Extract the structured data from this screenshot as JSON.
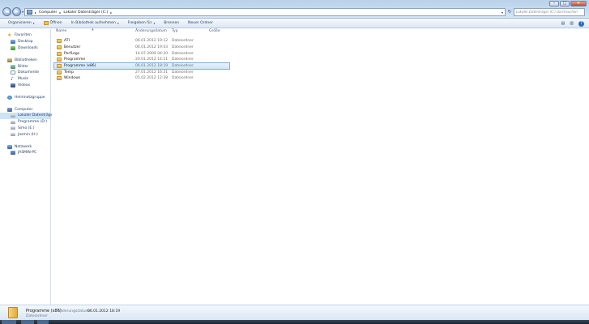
{
  "window": {
    "controls": {
      "minimize": "–",
      "maximize": "□",
      "close": "✕"
    }
  },
  "nav": {
    "back": "◄",
    "forward": "►",
    "dropdown": "▾"
  },
  "address": {
    "crumbs": [
      "Computer",
      "Lokaler Datenträger (C:)"
    ],
    "separator": "▸",
    "refresh": "↻",
    "search_placeholder": "Lokaler Datenträger (C:) durchsuchen"
  },
  "toolbar": {
    "items": [
      "Organisieren",
      "Öffnen",
      "In Bibliothek aufnehmen",
      "Freigeben für",
      "Brennen",
      "Neuer Ordner"
    ],
    "view_icon": "▤",
    "pane_icon": "▥",
    "help": "?"
  },
  "sidebar": {
    "favorites": {
      "header": "Favoriten",
      "items": [
        "Desktop",
        "Downloads"
      ]
    },
    "libraries": {
      "header": "Bibliotheken",
      "items": [
        "Bilder",
        "Dokumente",
        "Musik",
        "Videos"
      ]
    },
    "homegroup": {
      "header": "Heimnetzgruppe"
    },
    "computer": {
      "header": "Computer",
      "items": [
        "Lokaler Datenträger",
        "Programme (D:)",
        "Simo (E:)",
        "Jasmin (H:)"
      ]
    },
    "network": {
      "header": "Netzwerk",
      "items": [
        "JASMIN-PC"
      ]
    }
  },
  "columns": {
    "name": "Name",
    "date": "Änderungsdatum",
    "type": "Typ",
    "size": "Größe"
  },
  "files": [
    {
      "name": "ATI",
      "date": "06.01.2012 19:12",
      "type": "Dateiordner"
    },
    {
      "name": "Benutzer",
      "date": "06.01.2012 19:03",
      "type": "Dateiordner"
    },
    {
      "name": "PerfLogs",
      "date": "14.07.2009 04:20",
      "type": "Dateiordner"
    },
    {
      "name": "Programme",
      "date": "20.01.2012 14:21",
      "type": "Dateiordner"
    },
    {
      "name": "Programme (x86)",
      "date": "06.01.2012 18:19",
      "type": "Dateiordner"
    },
    {
      "name": "Temp",
      "date": "27.01.2012 16:31",
      "type": "Dateiordner"
    },
    {
      "name": "Windows",
      "date": "05.02.2012 12:38",
      "type": "Dateiordner"
    }
  ],
  "details": {
    "name": "Programme (x86)",
    "date_label": "Änderungsdatum:",
    "date_value": "06.01.2012 18:19",
    "type": "Dateiordner"
  }
}
